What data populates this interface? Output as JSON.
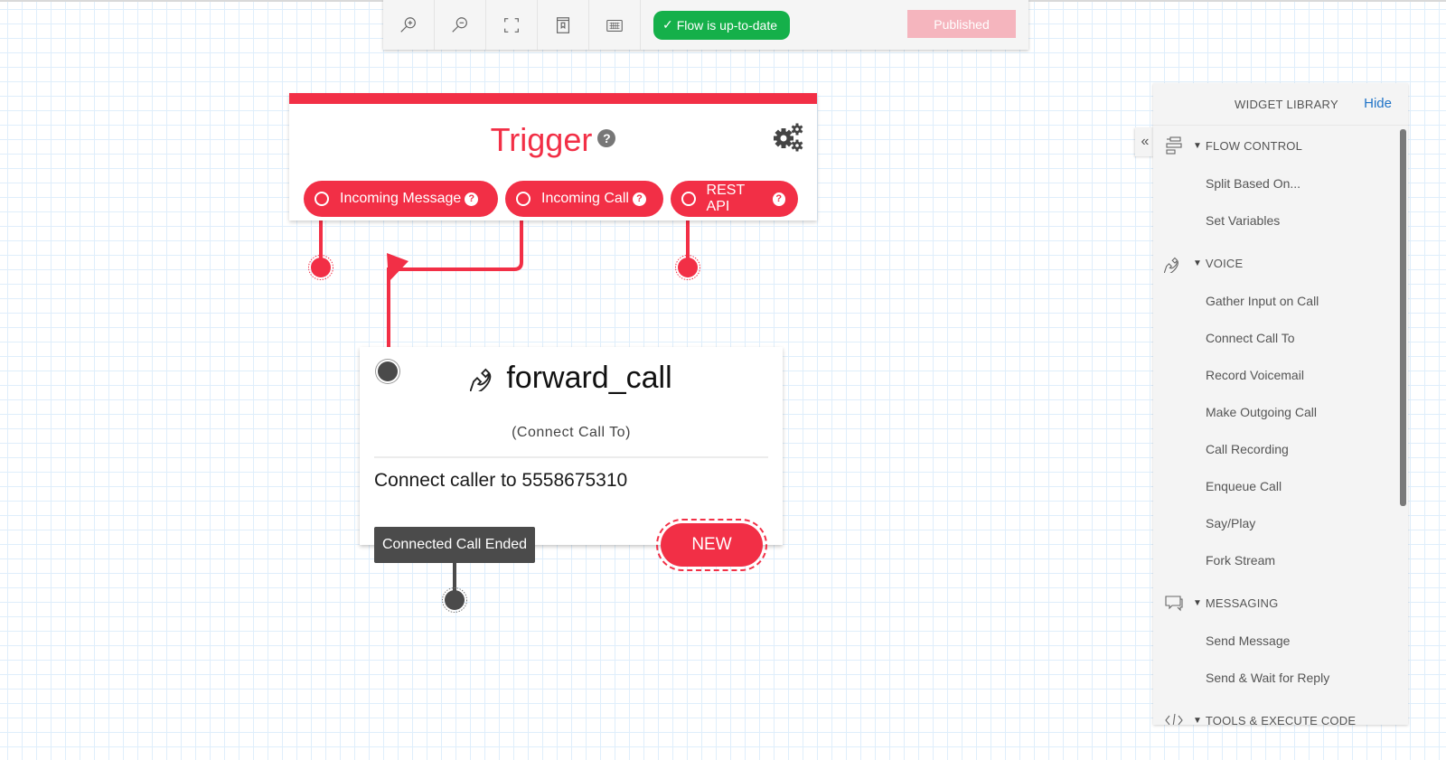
{
  "toolbar": {
    "buttons": [
      {
        "name": "zoom-in",
        "icon": "zoom-in-icon"
      },
      {
        "name": "zoom-out",
        "icon": "zoom-out-icon"
      },
      {
        "name": "fit-to-screen",
        "icon": "fit-screen-icon"
      },
      {
        "name": "save-draft",
        "icon": "bookmark-icon"
      },
      {
        "name": "keyboard-shortcuts",
        "icon": "keyboard-icon"
      }
    ],
    "status_label": "Flow is up-to-date",
    "status_color": "#15b04a",
    "publish_label": "Published"
  },
  "trigger": {
    "title": "Trigger",
    "accent_color": "#f22f46",
    "triggers": [
      {
        "label": "Incoming Message"
      },
      {
        "label": "Incoming Call"
      },
      {
        "label": "REST API"
      }
    ]
  },
  "widget": {
    "name": "forward_call",
    "type": "(Connect Call To)",
    "description": "Connect caller to 5558675310",
    "transition_label": "Connected Call Ended",
    "new_label": "NEW"
  },
  "library": {
    "title": "WIDGET LIBRARY",
    "hide_label": "Hide",
    "collapse_glyph": "«",
    "sections": [
      {
        "label": "FLOW CONTROL",
        "icon": "flow-control-icon",
        "items": [
          "Split Based On...",
          "Set Variables"
        ]
      },
      {
        "label": "VOICE",
        "icon": "phone-icon",
        "items": [
          "Gather Input on Call",
          "Connect Call To",
          "Record Voicemail",
          "Make Outgoing Call",
          "Call Recording",
          "Enqueue Call",
          "Say/Play",
          "Fork Stream"
        ]
      },
      {
        "label": "MESSAGING",
        "icon": "chat-icon",
        "items": [
          "Send Message",
          "Send & Wait for Reply"
        ]
      },
      {
        "label": "TOOLS & EXECUTE CODE",
        "icon": "code-icon",
        "items": []
      }
    ]
  }
}
